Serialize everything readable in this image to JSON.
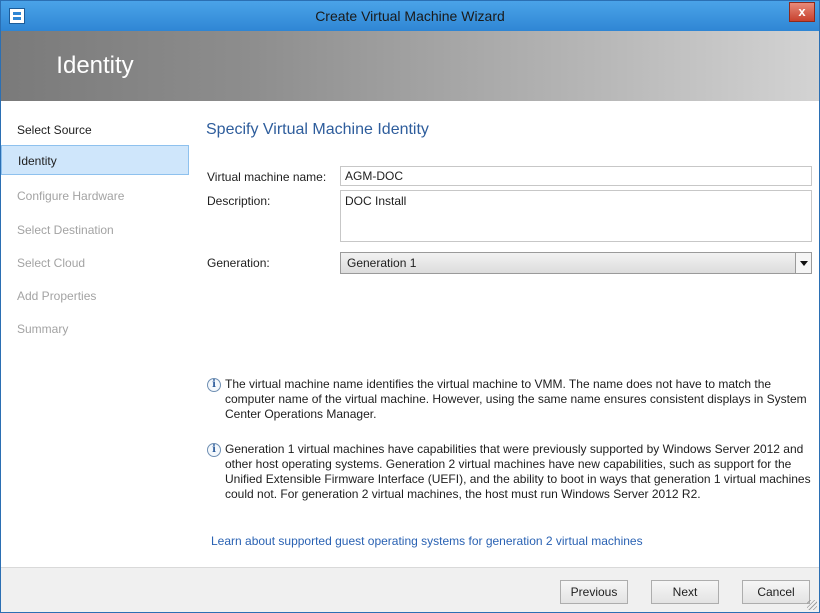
{
  "window": {
    "title": "Create Virtual Machine Wizard",
    "close_glyph": "x"
  },
  "banner": {
    "heading": "Identity"
  },
  "sidebar": {
    "items": [
      {
        "label": "Select Source",
        "state": "done"
      },
      {
        "label": "Identity",
        "state": "current"
      },
      {
        "label": "Configure Hardware",
        "state": "pending"
      },
      {
        "label": "Select Destination",
        "state": "pending"
      },
      {
        "label": "Select Cloud",
        "state": "pending"
      },
      {
        "label": "Add Properties",
        "state": "pending"
      },
      {
        "label": "Summary",
        "state": "pending"
      }
    ]
  },
  "main": {
    "section_title": "Specify Virtual Machine Identity",
    "vm_name_label": "Virtual machine name:",
    "vm_name_value": "AGM-DOC",
    "description_label": "Description:",
    "description_value": "DOC Install",
    "generation_label": "Generation:",
    "generation_value": "Generation 1",
    "info_icon_glyph": "i",
    "info_1": "The virtual machine name identifies the virtual machine to VMM. The name does not have to match the computer name of the virtual machine. However, using the same name ensures consistent displays in System Center Operations Manager.",
    "info_2": "Generation 1 virtual machines have capabilities that were previously supported by Windows Server 2012 and other host operating systems. Generation 2 virtual machines have new capabilities, such as support for the Unified Extensible Firmware Interface (UEFI), and the ability to boot in ways that generation 1 virtual machines could not. For generation 2 virtual machines, the host must run Windows Server 2012 R2.",
    "learn_link": "Learn about supported guest operating systems for generation 2 virtual machines"
  },
  "footer": {
    "previous_label": "Previous",
    "next_label": "Next",
    "cancel_label": "Cancel"
  },
  "colors": {
    "titlebar": "#2f86d4",
    "section_title": "#2e5d9c",
    "link": "#2a62b3",
    "nav_selected": "#cfe6fb"
  }
}
